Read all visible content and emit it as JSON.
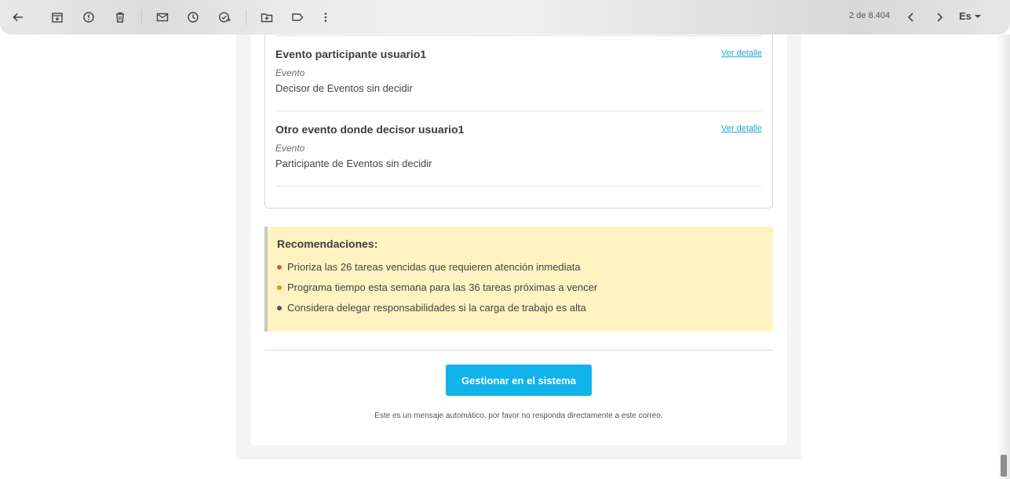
{
  "toolbar": {
    "count": "2 de 8.404",
    "lang": "Es",
    "icons": [
      "arrow-back-icon",
      "archive-icon",
      "report-spam-icon",
      "delete-icon",
      "mark-unread-icon",
      "snooze-icon",
      "add-task-icon",
      "move-to-icon",
      "label-icon",
      "more-vert-icon",
      "chevron-left-icon",
      "chevron-right-icon"
    ]
  },
  "events": [
    {
      "title": "Evento participante usuario1",
      "link": "Ver detalle",
      "type": "Evento",
      "desc": "Decisor de Eventos sin decidir"
    },
    {
      "title": "Otro evento donde decisor usuario1",
      "link": "Ver detalle",
      "type": "Evento",
      "desc": "Participante de Eventos sin decidir"
    }
  ],
  "recommendations": {
    "title": "Recomendaciones:",
    "items": [
      {
        "text": "Prioriza las 26 tareas vencidas que requieren atención inmediata",
        "color": "#e8543f"
      },
      {
        "text": "Programa tiempo esta semana para las 36 tareas próximas a vencer",
        "color": "#f08a24"
      },
      {
        "text": "Considera delegar responsabilidades si la carga de trabajo es alta",
        "color": "#555555"
      }
    ]
  },
  "cta": {
    "label": "Gestionar en el sistema"
  },
  "footer": {
    "note": "Este es un mensaje automático, por favor no responda directamente a este correo."
  },
  "colors": {
    "accent": "#10b4ea",
    "link": "#1ea7d7",
    "reco_bg": "#fff3c2"
  }
}
